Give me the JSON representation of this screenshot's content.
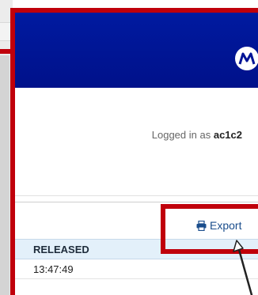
{
  "header": {
    "logo_icon": "motorola-logo-icon",
    "background_color": "#001496"
  },
  "user": {
    "logged_in_prefix": "Logged in as",
    "username": "ac1c2"
  },
  "toolbar": {
    "export_label": "Export",
    "export_icon": "printer-icon"
  },
  "table": {
    "columns": [
      "RELEASED"
    ],
    "rows": [
      [
        "13:47:49"
      ]
    ]
  },
  "annotation": {
    "highlight_color": "#c0000b"
  }
}
